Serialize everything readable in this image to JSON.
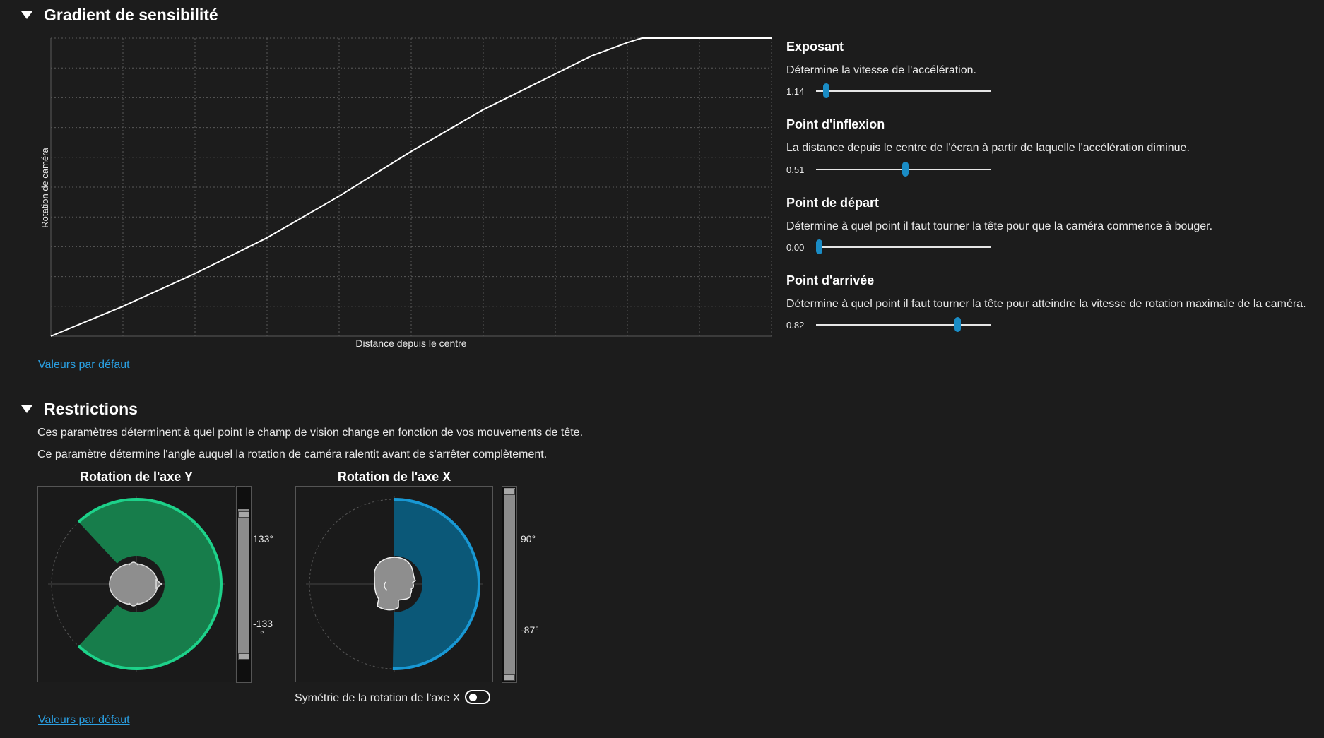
{
  "sensitivity": {
    "section_title": "Gradient de sensibilité",
    "chart": {
      "ylabel": "Rotation de caméra",
      "xlabel": "Distance depuis le centre"
    },
    "defaults_link": "Valeurs par défaut",
    "params": [
      {
        "title": "Exposant",
        "desc": "Détermine la vitesse de l'accélération.",
        "value": "1.14",
        "fraction": 0.04
      },
      {
        "title": "Point d'inflexion",
        "desc": "La distance depuis le centre de l'écran à partir de laquelle l'accélération diminue.",
        "value": "0.51",
        "fraction": 0.51
      },
      {
        "title": "Point de départ",
        "desc": "Détermine à quel point il faut tourner la tête pour que la caméra commence à bouger.",
        "value": "0.00",
        "fraction": 0.0
      },
      {
        "title": "Point d'arrivée",
        "desc": "Détermine à quel point il faut tourner la tête pour atteindre la vitesse de rotation maximale de la caméra.",
        "value": "0.82",
        "fraction": 0.82
      }
    ]
  },
  "chart_data": {
    "type": "line",
    "title": "",
    "xlabel": "Distance depuis le centre",
    "ylabel": "Rotation de caméra",
    "xlim": [
      0,
      1
    ],
    "ylim": [
      0,
      1
    ],
    "grid": true,
    "series": [
      {
        "x": [
          0,
          0.05,
          0.1,
          0.2,
          0.3,
          0.4,
          0.5,
          0.6,
          0.7,
          0.75,
          0.8,
          0.82,
          0.9,
          1.0
        ],
        "y": [
          0,
          0.05,
          0.1,
          0.21,
          0.33,
          0.47,
          0.62,
          0.76,
          0.88,
          0.94,
          0.985,
          1.0,
          1.0,
          1.0
        ]
      }
    ]
  },
  "restrictions": {
    "section_title": "Restrictions",
    "desc1": "Ces paramètres déterminent à quel point le champ de vision change en fonction de vos mouvements de tête.",
    "desc2": "Ce paramètre détermine l'angle auquel la rotation de caméra ralentit avant de s'arrêter complètement.",
    "y_axis": {
      "title": "Rotation de l'axe Y",
      "max_label": "133°",
      "min_label_line1": "-133",
      "min_label_line2": "°",
      "color": "#1dd28a",
      "fill": "#177d4b"
    },
    "x_axis": {
      "title": "Rotation de l'axe X",
      "max_label": "90°",
      "min_label": "-87°",
      "color": "#1898d4",
      "fill": "#0b5878"
    },
    "symmetry_label": "Symétrie de la rotation de l'axe X",
    "symmetry_on": false,
    "defaults_link": "Valeurs par défaut"
  }
}
